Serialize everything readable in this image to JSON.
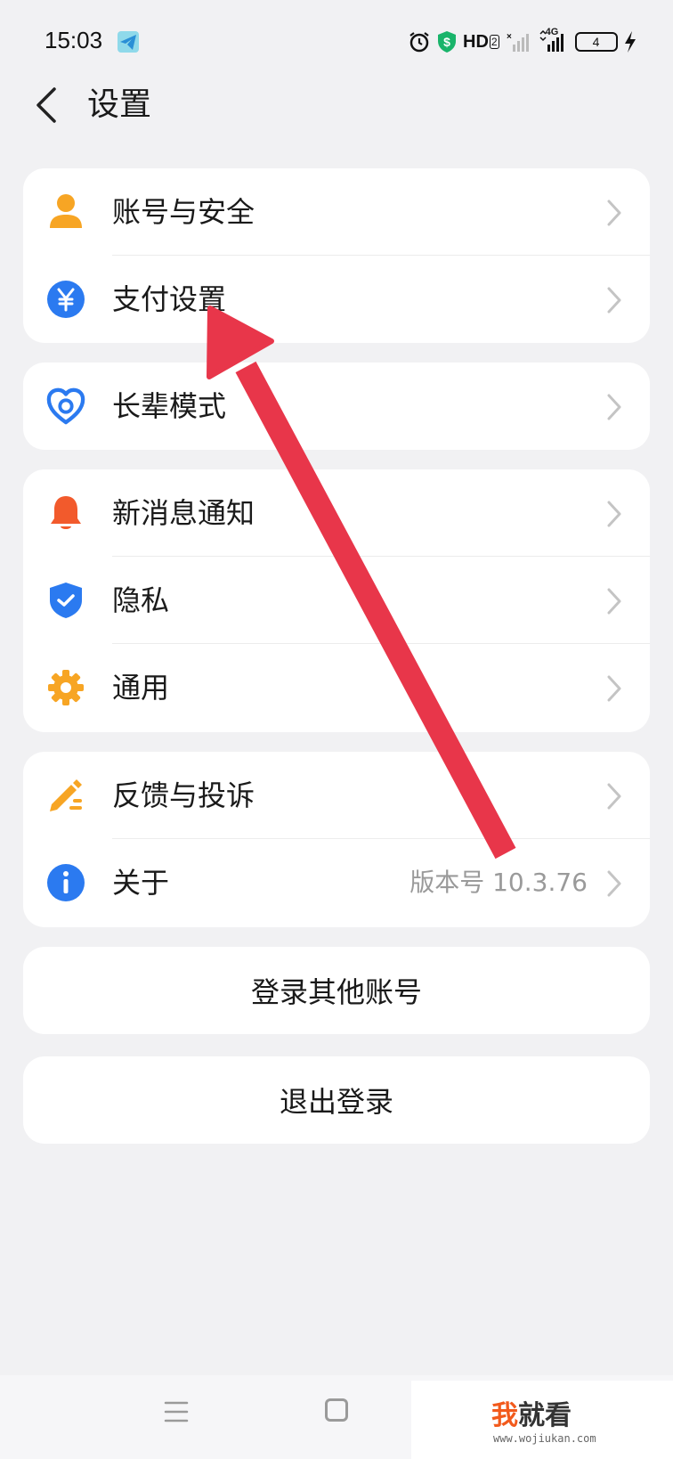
{
  "status_bar": {
    "time": "15:03",
    "hd_label": "HD",
    "hd_sub": "2",
    "network_label": "4G",
    "battery_level": "4",
    "icons": [
      "telegram-icon",
      "alarm-icon",
      "shield-dollar-icon",
      "signal-x-icon",
      "signal-4g-icon",
      "battery-icon",
      "charging-bolt-icon"
    ]
  },
  "header": {
    "title": "设置"
  },
  "sections": [
    {
      "items": [
        {
          "label": "账号与安全",
          "icon": "person-icon"
        },
        {
          "label": "支付设置",
          "icon": "yuan-icon"
        }
      ]
    },
    {
      "items": [
        {
          "label": "长辈模式",
          "icon": "heart-icon"
        }
      ]
    },
    {
      "items": [
        {
          "label": "新消息通知",
          "icon": "bell-icon"
        },
        {
          "label": "隐私",
          "icon": "shield-check-icon"
        },
        {
          "label": "通用",
          "icon": "gear-icon"
        }
      ]
    },
    {
      "items": [
        {
          "label": "反馈与投诉",
          "icon": "pencil-icon"
        },
        {
          "label": "关于",
          "icon": "info-icon",
          "value": "版本号 10.3.76"
        }
      ]
    }
  ],
  "buttons": {
    "switch_account": "登录其他账号",
    "logout": "退出登录"
  },
  "watermark": {
    "wo": "我",
    "rest": "就看",
    "url": "www.wojiukan.com"
  },
  "colors": {
    "background": "#f1f1f3",
    "card": "#ffffff",
    "arrow": "#e8364a",
    "orange": "#f7a524",
    "blue": "#2b7af0",
    "bell": "#f25a2c"
  }
}
